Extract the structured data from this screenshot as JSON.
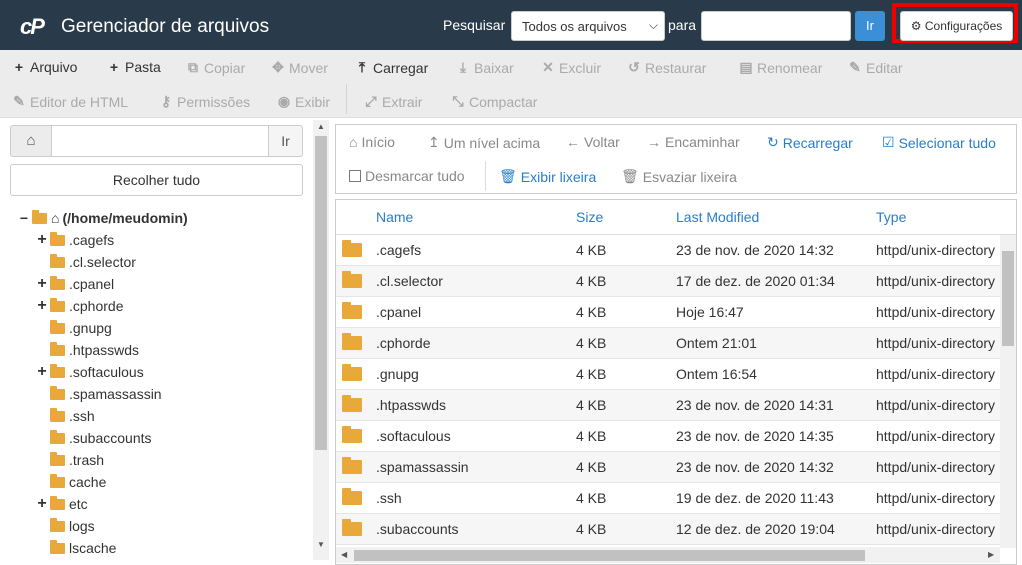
{
  "header": {
    "logo": "cP",
    "title": "Gerenciador de arquivos",
    "search_label": "Pesquisar",
    "search_scope": "Todos os arquivos",
    "para_label": "para",
    "search_value": "",
    "go_label": "Ir",
    "settings_label": "Configurações",
    "highlight_color": "#ee0000"
  },
  "toolbar": {
    "row1": [
      {
        "icon": "plus-icon",
        "label": "Arquivo",
        "enabled": true
      },
      {
        "icon": "plus-icon",
        "label": "Pasta",
        "enabled": true
      },
      {
        "icon": "copy-icon",
        "label": "Copiar",
        "enabled": false
      },
      {
        "icon": "move-icon",
        "label": "Mover",
        "enabled": false
      },
      {
        "icon": "upload-icon",
        "label": "Carregar",
        "enabled": true
      },
      {
        "icon": "download-icon",
        "label": "Baixar",
        "enabled": false
      },
      {
        "icon": "delete-icon",
        "label": "Excluir",
        "enabled": false
      },
      {
        "icon": "restore-icon",
        "label": "Restaurar",
        "enabled": false
      },
      {
        "icon": "file-icon",
        "label": "Renomear",
        "enabled": false
      },
      {
        "icon": "pencil-icon",
        "label": "Editar",
        "enabled": false
      }
    ],
    "row2": [
      {
        "icon": "edit-icon",
        "label": "Editor de HTML",
        "enabled": false
      },
      {
        "icon": "key-icon",
        "label": "Permissões",
        "enabled": false
      },
      {
        "icon": "eye-icon",
        "label": "Exibir",
        "enabled": false
      },
      {
        "icon": "expand-icon",
        "label": "Extrair",
        "enabled": false
      },
      {
        "icon": "compress-icon",
        "label": "Compactar",
        "enabled": false
      }
    ]
  },
  "left": {
    "path_value": "",
    "go_label": "Ir",
    "collapse_label": "Recolher tudo",
    "root_label": "(/home/meudomin)",
    "tree": [
      {
        "label": ".cagefs",
        "expandable": true
      },
      {
        "label": ".cl.selector",
        "expandable": false
      },
      {
        "label": ".cpanel",
        "expandable": true
      },
      {
        "label": ".cphorde",
        "expandable": true
      },
      {
        "label": ".gnupg",
        "expandable": false
      },
      {
        "label": ".htpasswds",
        "expandable": false
      },
      {
        "label": ".softaculous",
        "expandable": true
      },
      {
        "label": ".spamassassin",
        "expandable": false
      },
      {
        "label": ".ssh",
        "expandable": false
      },
      {
        "label": ".subaccounts",
        "expandable": false
      },
      {
        "label": ".trash",
        "expandable": false
      },
      {
        "label": "cache",
        "expandable": false
      },
      {
        "label": "etc",
        "expandable": true
      },
      {
        "label": "logs",
        "expandable": false
      },
      {
        "label": "lscache",
        "expandable": false
      }
    ]
  },
  "nav": {
    "home": "Início",
    "up": "Um nível acima",
    "back": "Voltar",
    "forward": "Encaminhar",
    "reload": "Recarregar",
    "select_all": "Selecionar tudo",
    "deselect_all": "Desmarcar tudo",
    "show_trash": "Exibir lixeira",
    "empty_trash": "Esvaziar lixeira"
  },
  "table": {
    "columns": [
      "Name",
      "Size",
      "Last Modified",
      "Type"
    ],
    "rows": [
      {
        "name": ".cagefs",
        "size": "4 KB",
        "modified": "23 de nov. de 2020 14:32",
        "type": "httpd/unix-directory"
      },
      {
        "name": ".cl.selector",
        "size": "4 KB",
        "modified": "17 de dez. de 2020 01:34",
        "type": "httpd/unix-directory"
      },
      {
        "name": ".cpanel",
        "size": "4 KB",
        "modified": "Hoje 16:47",
        "type": "httpd/unix-directory"
      },
      {
        "name": ".cphorde",
        "size": "4 KB",
        "modified": "Ontem 21:01",
        "type": "httpd/unix-directory"
      },
      {
        "name": ".gnupg",
        "size": "4 KB",
        "modified": "Ontem 16:54",
        "type": "httpd/unix-directory"
      },
      {
        "name": ".htpasswds",
        "size": "4 KB",
        "modified": "23 de nov. de 2020 14:31",
        "type": "httpd/unix-directory"
      },
      {
        "name": ".softaculous",
        "size": "4 KB",
        "modified": "23 de nov. de 2020 14:35",
        "type": "httpd/unix-directory"
      },
      {
        "name": ".spamassassin",
        "size": "4 KB",
        "modified": "23 de nov. de 2020 14:32",
        "type": "httpd/unix-directory"
      },
      {
        "name": ".ssh",
        "size": "4 KB",
        "modified": "19 de dez. de 2020 11:43",
        "type": "httpd/unix-directory"
      },
      {
        "name": ".subaccounts",
        "size": "4 KB",
        "modified": "12 de dez. de 2020 19:04",
        "type": "httpd/unix-directory"
      }
    ]
  }
}
